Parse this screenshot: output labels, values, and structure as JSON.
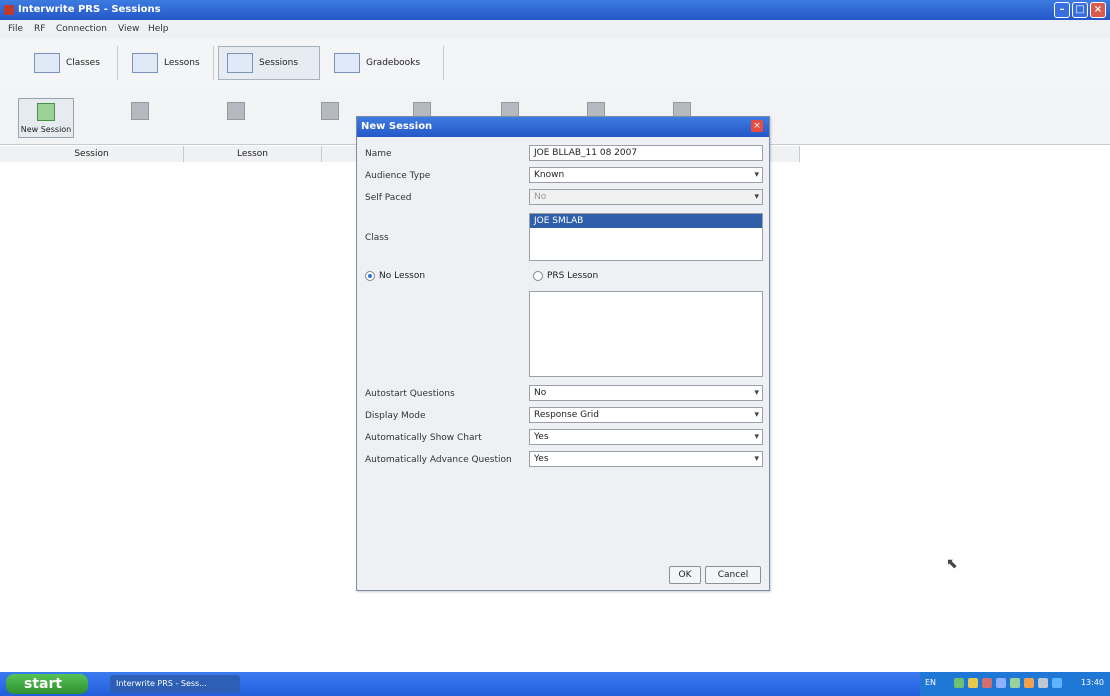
{
  "window": {
    "title": "Interwrite PRS - Sessions"
  },
  "menu": {
    "items": [
      "File",
      "RF",
      "Connection",
      "View",
      "Help"
    ]
  },
  "tabs": [
    {
      "label": "Classes",
      "icon": "classes-icon"
    },
    {
      "label": "Lessons",
      "icon": "lessons-icon"
    },
    {
      "label": "Sessions",
      "icon": "sessions-icon",
      "active": true
    },
    {
      "label": "Gradebooks",
      "icon": "gradebooks-icon"
    }
  ],
  "toolbar": {
    "new_session": "New Session"
  },
  "grid": {
    "headers": [
      "Session",
      "Lesson"
    ]
  },
  "dialog": {
    "title": "New Session",
    "fields": {
      "name_label": "Name",
      "name_value": "JOE BLLAB_11 08 2007",
      "audience_type_label": "Audience Type",
      "audience_type_value": "Known",
      "self_paced_label": "Self Paced",
      "self_paced_value": "No",
      "class_label": "Class",
      "class_selected": "JOE SMLAB",
      "no_lesson_label": "No Lesson",
      "prs_lesson_label": "PRS Lesson",
      "autostart_label": "Autostart Questions",
      "autostart_value": "No",
      "display_mode_label": "Display Mode",
      "display_mode_value": "Response Grid",
      "auto_show_chart_label": "Automatically Show Chart",
      "auto_show_chart_value": "Yes",
      "auto_advance_label": "Automatically Advance Question",
      "auto_advance_value": "Yes"
    },
    "buttons": {
      "ok": "OK",
      "cancel": "Cancel"
    }
  },
  "taskbar": {
    "start": "start",
    "task_label": "Interwrite PRS - Sess...",
    "language": "EN",
    "clock": "13:40"
  }
}
